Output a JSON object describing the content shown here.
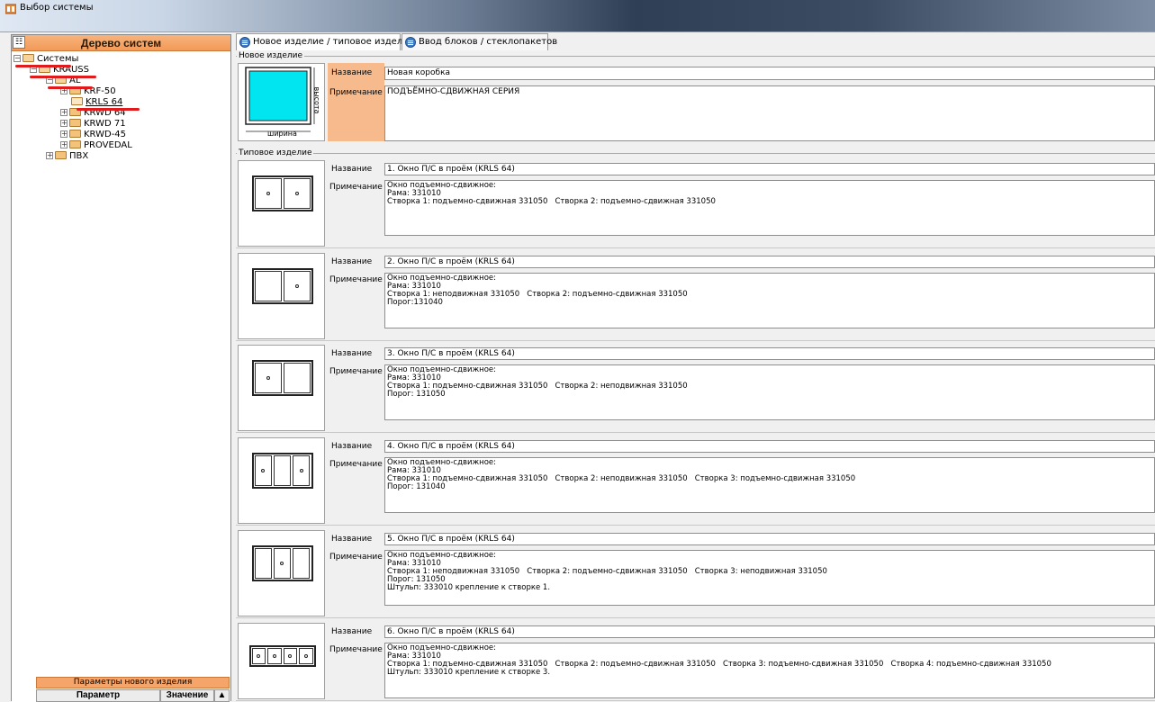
{
  "window": {
    "title": "Выбор системы"
  },
  "tree": {
    "header": "Дерево систем",
    "nodes": [
      {
        "label": "Системы"
      },
      {
        "label": "KRAUSS"
      },
      {
        "label": "AL"
      },
      {
        "label": "KRF-50"
      },
      {
        "label": "KRLS 64"
      },
      {
        "label": "KRWD 64"
      },
      {
        "label": "KRWD 71"
      },
      {
        "label": "KRWD-45"
      },
      {
        "label": "PROVEDAL"
      },
      {
        "label": "ПВХ"
      }
    ]
  },
  "params": {
    "title": "Параметры нового изделия",
    "col_param": "Параметр",
    "col_value": "Значение"
  },
  "tabs": [
    {
      "label": "Новое изделие / типовое изделие"
    },
    {
      "label": "Ввод блоков / стеклопакетов"
    }
  ],
  "new_item": {
    "group_label": "Новое изделие",
    "name_label": "Название",
    "name_value": "Новая коробка",
    "note_label": "Примечание",
    "note_value": "ПОДЪЁМНО-СДВИЖНАЯ СЕРИЯ",
    "width_label": "ширина",
    "height_label": "высота"
  },
  "typical": {
    "group_label": "Типовое изделие",
    "name_label": "Название",
    "note_label": "Примечание",
    "items": [
      {
        "name": "1. Окно П/С в проём (KRLS 64)",
        "note": "Окно подъемно-сдвижное:\nРама: 331010\nСтворка 1: подъемно-сдвижная 331050   Створка 2: подъемно-сдвижная 331050"
      },
      {
        "name": "2. Окно П/С в проём (KRLS 64)",
        "note": "Окно подъемно-сдвижное:\nРама: 331010\nСтворка 1: неподвижная 331050   Створка 2: подъемно-сдвижная 331050\nПорог:131040"
      },
      {
        "name": "3. Окно П/С в проём (KRLS 64)",
        "note": "Окно подъемно-сдвижное:\nРама: 331010\nСтворка 1: подъемно-сдвижная 331050   Створка 2: неподвижная 331050\nПорог: 131050"
      },
      {
        "name": "4. Окно П/С в проём (KRLS 64)",
        "note": "Окно подъемно-сдвижное:\nРама: 331010\nСтворка 1: подъемно-сдвижная 331050   Створка 2: неподвижная 331050   Створка 3: подъемно-сдвижная 331050\nПорог: 131040"
      },
      {
        "name": "5. Окно П/С в проём (KRLS 64)",
        "note": "Окно подъемно-сдвижное:\nРама: 331010\nСтворка 1: неподвижная 331050   Створка 2: подъемно-сдвижная 331050   Створка 3: неподвижная 331050\nПорог: 131050\nШтульп: 333010 крепление к створке 1."
      },
      {
        "name": "6. Окно П/С в проём (KRLS 64)",
        "note": "Окно подъемно-сдвижное:\nРама: 331010\nСтворка 1: подъемно-сдвижная 331050   Створка 2: подъемно-сдвижная 331050   Створка 3: подъемно-сдвижная 331050   Створка 4: подъемно-сдвижная 331050\nШтульп: 333010 крепление к створке 3."
      }
    ]
  },
  "colors": {
    "accent_orange": "#f39a57",
    "preview_glass": "#00e5f0",
    "annotation_red": "#e11b1b"
  }
}
